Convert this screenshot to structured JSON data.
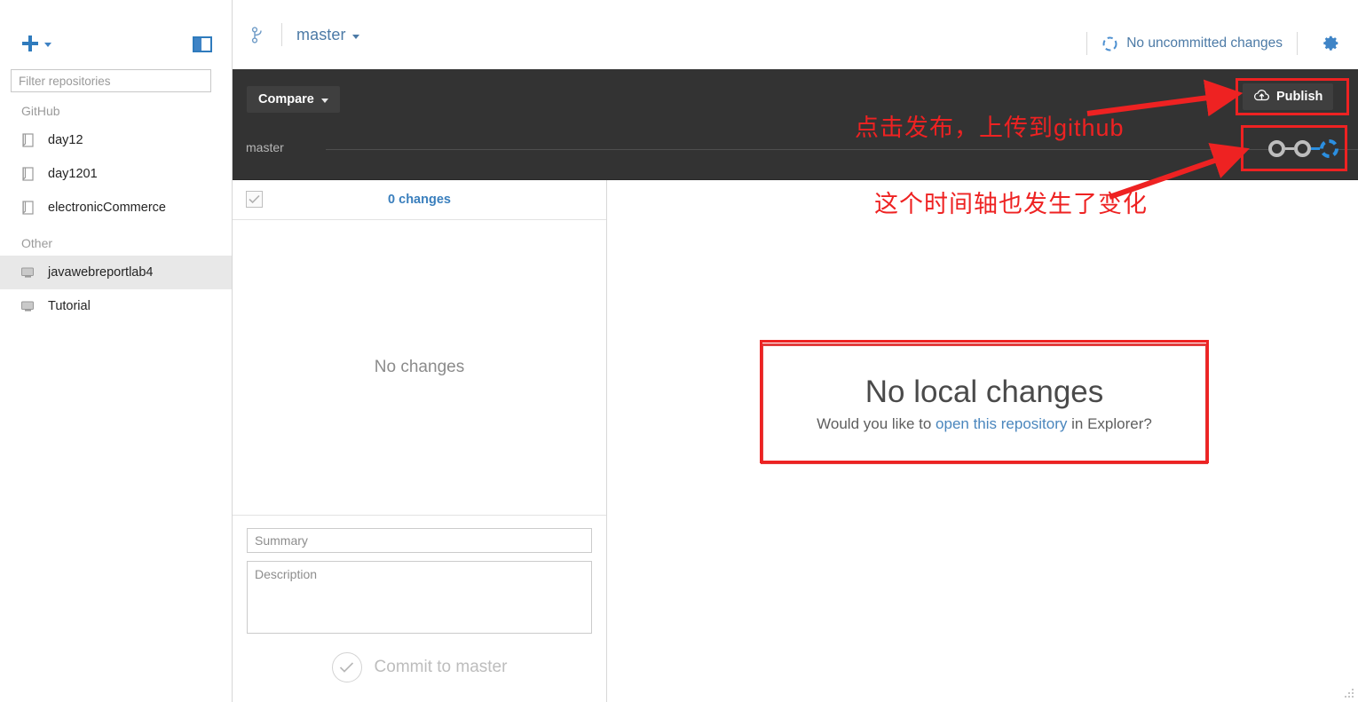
{
  "window": {
    "minimize_label": "—",
    "maximize_label": "□",
    "close_label": "×"
  },
  "sidebar": {
    "add_button_label": "+",
    "filter_placeholder": "Filter repositories",
    "filter_value": "",
    "groups": [
      {
        "name": "GitHub",
        "icon": "repo-book-icon",
        "items": [
          {
            "label": "day12",
            "selected": false
          },
          {
            "label": "day1201",
            "selected": false
          },
          {
            "label": "electronicCommerce",
            "selected": false
          }
        ]
      },
      {
        "name": "Other",
        "icon": "repo-computer-icon",
        "items": [
          {
            "label": "javawebreportlab4",
            "selected": true
          },
          {
            "label": "Tutorial",
            "selected": false
          }
        ]
      }
    ]
  },
  "topbar": {
    "branch_icon": "branch-icon",
    "branch_name": "master",
    "sync_status": "No uncommitted changes",
    "sync_icon": "sync-circle-icon",
    "settings_icon": "gear-icon"
  },
  "toolbar": {
    "compare_label": "Compare",
    "publish_label": "Publish",
    "publish_icon": "cloud-upload-icon",
    "timeline_branch_label": "master",
    "commit_nodes": [
      {
        "state": "past"
      },
      {
        "state": "past"
      },
      {
        "state": "current"
      }
    ]
  },
  "changes": {
    "select_all_checked": true,
    "count_label": "0 changes",
    "empty_label": "No changes",
    "summary_placeholder": "Summary",
    "summary_value": "",
    "description_placeholder": "Description",
    "description_value": "",
    "commit_button_label": "Commit to master",
    "commit_button_icon": "check-circle-icon"
  },
  "main": {
    "no_local_changes_title": "No local changes",
    "prompt_prefix": "Would you like to ",
    "prompt_link": "open this repository",
    "prompt_suffix": " in Explorer?"
  },
  "annotations": {
    "note_publish": "点击发布，上传到github",
    "note_timeline": "这个时间轴也发生了变化",
    "highlight_color": "#ee2222"
  },
  "colors": {
    "accent_blue": "#3f84c6",
    "dark_toolbar": "#333333",
    "link_blue": "#4a86bd",
    "annotation_red": "#ee2222",
    "selected_row": "#e8e8e8"
  }
}
